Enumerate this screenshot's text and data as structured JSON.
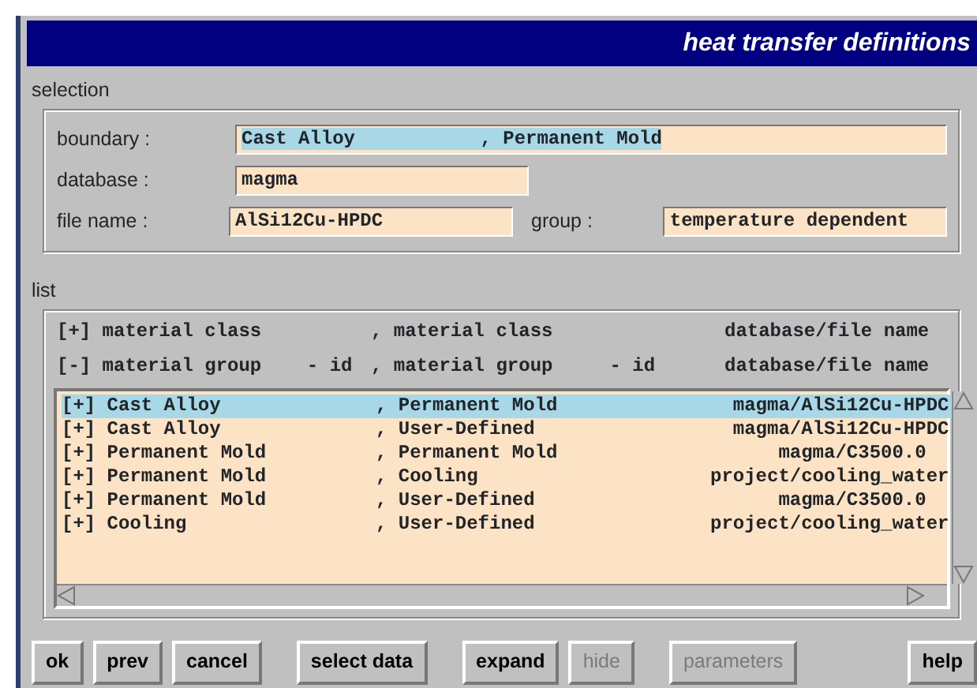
{
  "window": {
    "title": "heat transfer definitions"
  },
  "selection": {
    "label": "selection",
    "fields": [
      {
        "label": "boundary :",
        "value": "Cast Alloy           , Permanent Mold",
        "highlighted": true
      },
      {
        "label": "database :",
        "value": "magma",
        "highlighted": false
      },
      {
        "label": "file name :",
        "value": "AlSi12Cu-HPDC",
        "highlighted": false
      },
      {
        "label": "group :",
        "value": "temperature dependent",
        "highlighted": false
      }
    ]
  },
  "list": {
    "label": "list",
    "headers": [
      {
        "column_1": "[+] material class",
        "column_2": ", material class",
        "column_3": "database/file name"
      },
      {
        "column_1": "[-] material group    - id",
        "column_2": ", material group     - id",
        "column_3": "database/file name"
      }
    ],
    "rows": [
      {
        "column_1": "[+] Cast Alloy",
        "column_2": ", Permanent Mold",
        "column_3": "magma/AlSi12Cu-HPDC",
        "selected": true
      },
      {
        "column_1": "[+] Cast Alloy",
        "column_2": ", User-Defined",
        "column_3": "magma/AlSi12Cu-HPDC",
        "selected": false
      },
      {
        "column_1": "[+] Permanent Mold",
        "column_2": ", Permanent Mold",
        "column_3": "magma/C3500.0  ",
        "selected": false
      },
      {
        "column_1": "[+] Permanent Mold",
        "column_2": ", Cooling",
        "column_3": "project/cooling_water",
        "selected": false
      },
      {
        "column_1": "[+] Permanent Mold",
        "column_2": ", User-Defined",
        "column_3": "magma/C3500.0  ",
        "selected": false
      },
      {
        "column_1": "[+] Cooling",
        "column_2": ", User-Defined",
        "column_3": "project/cooling_water",
        "selected": false
      }
    ]
  },
  "button_groups": [
    [
      {
        "label": "ok",
        "disabled": false
      },
      {
        "label": "prev",
        "disabled": false
      },
      {
        "label": "cancel",
        "disabled": false
      }
    ],
    [
      {
        "label": "select data",
        "disabled": false
      }
    ],
    [
      {
        "label": "expand",
        "disabled": false
      },
      {
        "label": "hide",
        "disabled": true
      }
    ],
    [
      {
        "label": "parameters",
        "disabled": true
      }
    ],
    [
      {
        "label": "help",
        "disabled": false
      }
    ]
  ]
}
